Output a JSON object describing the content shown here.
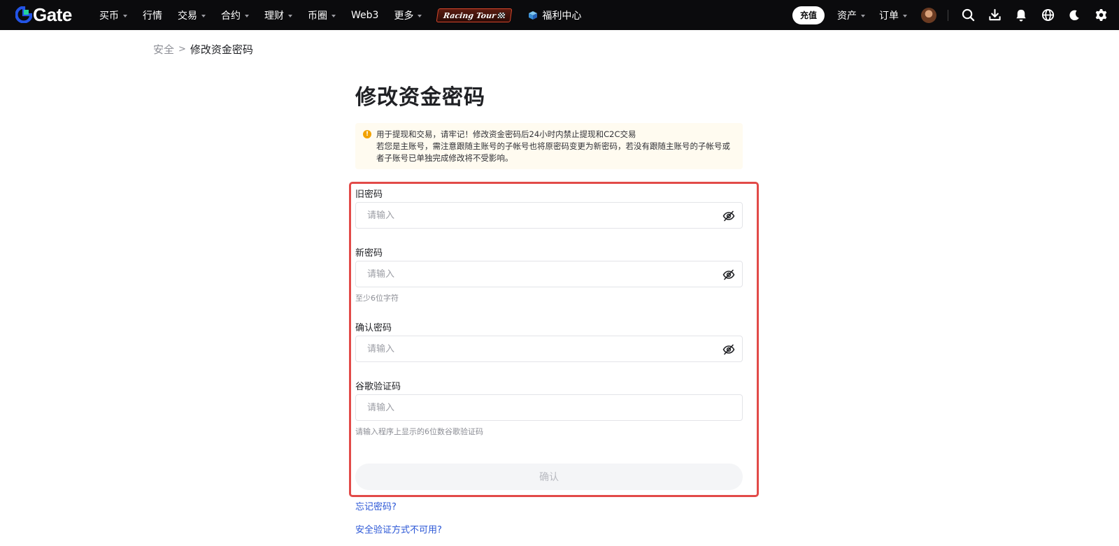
{
  "header": {
    "logo_text": "Gate",
    "nav": [
      {
        "label": "买币",
        "has_caret": true
      },
      {
        "label": "行情",
        "has_caret": false
      },
      {
        "label": "交易",
        "has_caret": true
      },
      {
        "label": "合约",
        "has_caret": true
      },
      {
        "label": "理财",
        "has_caret": true
      },
      {
        "label": "币圈",
        "has_caret": true
      },
      {
        "label": "Web3",
        "has_caret": false
      },
      {
        "label": "更多",
        "has_caret": true
      }
    ],
    "racing_label": "Racing Tour",
    "welfare_label": "福利中心",
    "deposit_label": "充值",
    "assets_label": "资产",
    "orders_label": "订单",
    "icons": [
      "search-icon",
      "download-icon",
      "bell-icon",
      "globe-icon",
      "moon-icon",
      "gear-icon"
    ]
  },
  "breadcrumb": {
    "parent": "安全",
    "separator": ">",
    "current": "修改资金密码"
  },
  "page": {
    "title": "修改资金密码",
    "notice_line1": "用于提现和交易，请牢记！修改资金密码后24小时内禁止提现和C2C交易",
    "notice_line2": "若您是主账号，需注意跟随主账号的子帐号也将原密码变更为新密码，若没有跟随主账号的子帐号或者子账号已单独完成修改将不受影响。"
  },
  "form": {
    "old_password": {
      "label": "旧密码",
      "placeholder": "请输入"
    },
    "new_password": {
      "label": "新密码",
      "placeholder": "请输入",
      "hint": "至少6位字符"
    },
    "confirm_password": {
      "label": "确认密码",
      "placeholder": "请输入"
    },
    "google_code": {
      "label": "谷歌验证码",
      "placeholder": "请输入",
      "hint": "请输入程序上显示的6位数谷歌验证码"
    },
    "submit_label": "确认"
  },
  "links": {
    "forgot_password": "忘记密码?",
    "verification_unavailable": "安全验证方式不可用?"
  },
  "colors": {
    "nav_bg": "#0b0b0d",
    "brand_blue": "#2354e6",
    "highlight_red": "#e24a48",
    "link_blue": "#2a56d6",
    "notice_bg": "#fffbf0",
    "warning_orange": "#f2a200"
  }
}
